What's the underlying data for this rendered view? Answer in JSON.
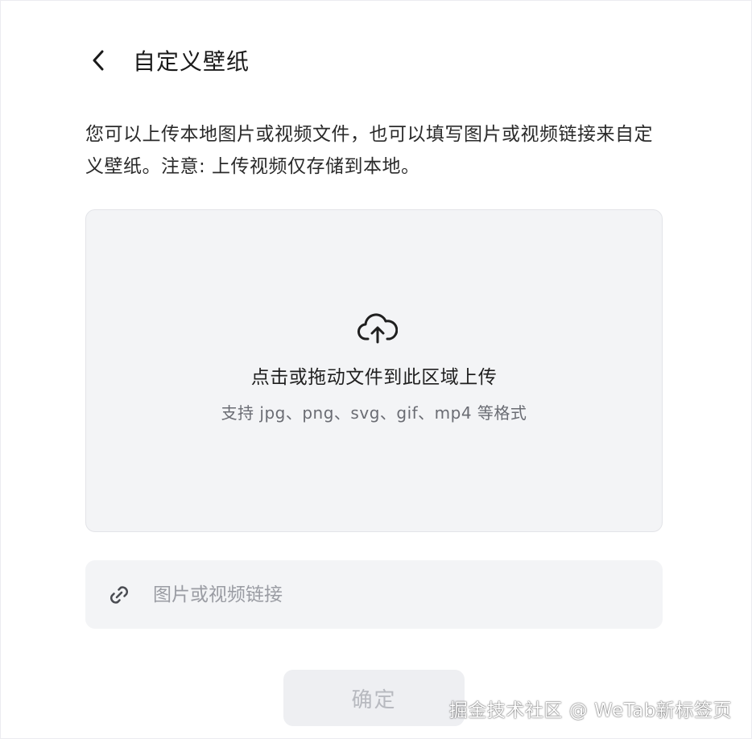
{
  "header": {
    "title": "自定义壁纸",
    "back_icon": "chevron-left-icon"
  },
  "description": "您可以上传本地图片或视频文件，也可以填写图片或视频链接来自定义壁纸。注意: 上传视频仅存储到本地。",
  "upload": {
    "icon": "cloud-upload-icon",
    "title": "点击或拖动文件到此区域上传",
    "hint": "支持 jpg、png、svg、gif、mp4 等格式"
  },
  "url_input": {
    "icon": "link-icon",
    "placeholder": "图片或视频链接",
    "value": ""
  },
  "confirm_label": "确定",
  "watermark": "掘金技术社区 @ WeTab新标签页",
  "colors": {
    "surface": "#f3f4f6",
    "text": "#1f1f1f",
    "muted": "#6a6c73",
    "placeholder": "#9a9ca3",
    "disabled_button": "#eeeff2"
  }
}
